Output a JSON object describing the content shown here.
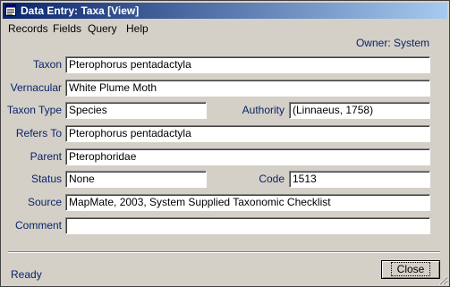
{
  "window": {
    "title": "Data Entry: Taxa [View]"
  },
  "menu": [
    "Records",
    "Fields",
    "Query",
    "Help"
  ],
  "owner": "Owner: System",
  "fields": {
    "taxon": {
      "label": "Taxon",
      "value": "Pterophorus pentadactyla"
    },
    "vernacular": {
      "label": "Vernacular",
      "value": "White Plume Moth"
    },
    "taxon_type": {
      "label": "Taxon Type",
      "value": "Species"
    },
    "authority": {
      "label": "Authority",
      "value": "(Linnaeus, 1758)"
    },
    "refers_to": {
      "label": "Refers To",
      "value": "Pterophorus pentadactyla"
    },
    "parent": {
      "label": "Parent",
      "value": "Pterophoridae"
    },
    "status": {
      "label": "Status",
      "value": "None"
    },
    "code": {
      "label": "Code",
      "value": "1513"
    },
    "source": {
      "label": "Source",
      "value": "MapMate, 2003, System Supplied Taxonomic Checklist"
    },
    "comment": {
      "label": "Comment",
      "value": ""
    }
  },
  "statusbar": {
    "text": "Ready"
  },
  "buttons": {
    "close": "Close"
  },
  "colors": {
    "title_bar": "#0a246a",
    "label": "#0a246a",
    "window_bg": "#d4d0c8"
  }
}
